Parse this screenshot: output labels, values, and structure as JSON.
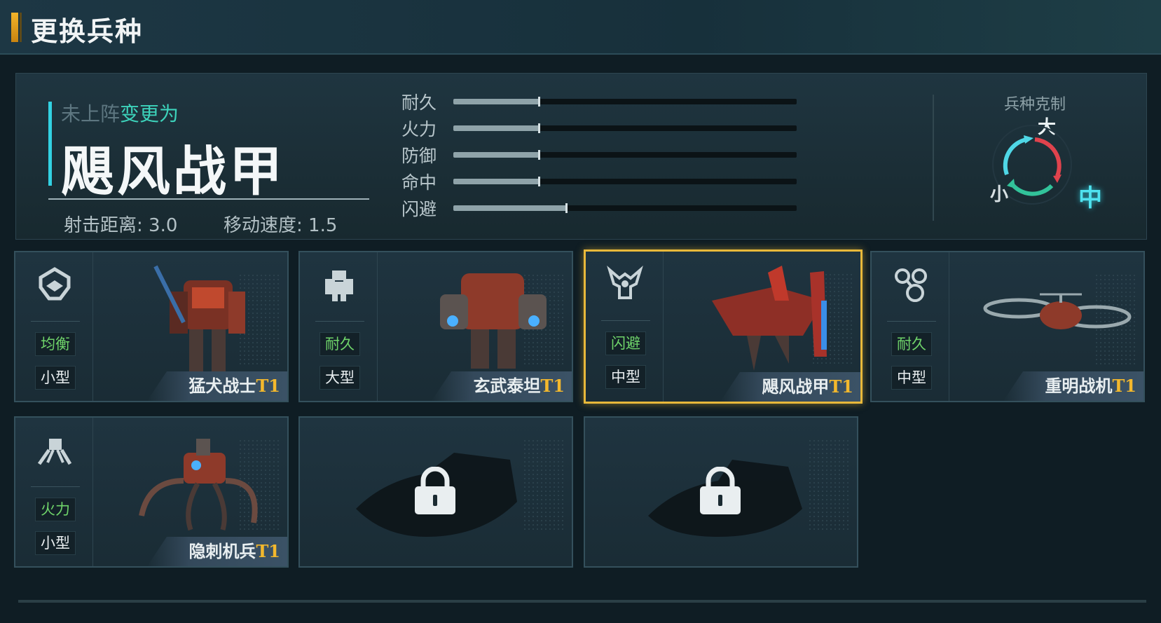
{
  "header": {
    "title": "更换兵种"
  },
  "selected_unit": {
    "status_off": "未上阵",
    "status_change": "变更为",
    "name": "飓风战甲",
    "range_label": "射击距离: 3.0",
    "speed_label": "移动速度: 1.5"
  },
  "attributes": [
    {
      "label": "耐久",
      "value": 0.25
    },
    {
      "label": "火力",
      "value": 0.25
    },
    {
      "label": "防御",
      "value": 0.25
    },
    {
      "label": "命中",
      "value": 0.25
    },
    {
      "label": "闪避",
      "value": 0.33
    }
  ],
  "counter": {
    "title": "兵种克制",
    "large": "大",
    "medium": "中",
    "small": "小",
    "colors": {
      "arrow_large_to_mid": "#e0434d",
      "arrow_mid_to_small": "#32c39a",
      "arrow_small_to_large": "#4fd7e6"
    }
  },
  "cards": [
    {
      "icon": "balanced-helmet-icon",
      "role": "均衡",
      "size": "小型",
      "name": "猛犬战士",
      "tier": "T1",
      "selected": false,
      "locked": false
    },
    {
      "icon": "heavy-mech-icon",
      "role": "耐久",
      "size": "大型",
      "name": "玄武泰坦",
      "tier": "T1",
      "selected": false,
      "locked": false
    },
    {
      "icon": "winged-mech-icon",
      "role": "闪避",
      "size": "中型",
      "name": "飓风战甲",
      "tier": "T1",
      "selected": true,
      "locked": false
    },
    {
      "icon": "drone-rotor-icon",
      "role": "耐久",
      "size": "中型",
      "name": "重明战机",
      "tier": "T1",
      "selected": false,
      "locked": false
    },
    {
      "icon": "spider-walker-icon",
      "role": "火力",
      "size": "小型",
      "name": "隐刺机兵",
      "tier": "T1",
      "selected": false,
      "locked": false
    },
    {
      "locked": true
    },
    {
      "locked": true
    }
  ],
  "colors": {
    "accent_gold": "#e8b83a",
    "accent_cyan": "#32d1e2",
    "role_green": "#6fd46a"
  }
}
